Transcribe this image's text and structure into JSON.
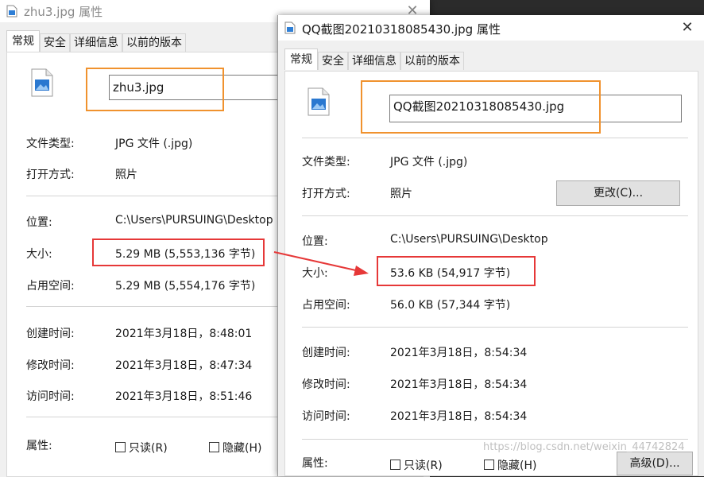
{
  "colors": {
    "highlight_orange": "#f0922e",
    "highlight_red": "#e63838"
  },
  "left_dialog": {
    "title": "zhu3.jpg 属性",
    "tabs": [
      "常规",
      "安全",
      "详细信息",
      "以前的版本"
    ],
    "filename": "zhu3.jpg",
    "rows": {
      "type_label": "文件类型:",
      "type_value": "JPG 文件 (.jpg)",
      "open_label": "打开方式:",
      "open_value": "照片",
      "location_label": "位置:",
      "location_value": "C:\\Users\\PURSUING\\Desktop",
      "size_label": "大小:",
      "size_value": "5.29 MB (5,553,136 字节)",
      "disk_label": "占用空间:",
      "disk_value": "5.29 MB (5,554,176 字节)",
      "created_label": "创建时间:",
      "created_value": "2021年3月18日，8:48:01",
      "modified_label": "修改时间:",
      "modified_value": "2021年3月18日，8:47:34",
      "accessed_label": "访问时间:",
      "accessed_value": "2021年3月18日，8:51:46",
      "attr_label": "属性:",
      "readonly": "只读(R)",
      "hidden": "隐藏(H)"
    }
  },
  "right_dialog": {
    "title": "QQ截图20210318085430.jpg 属性",
    "tabs": [
      "常规",
      "安全",
      "详细信息",
      "以前的版本"
    ],
    "filename": "QQ截图20210318085430.jpg",
    "change_button": "更改(C)...",
    "advanced_button": "高级(D)...",
    "rows": {
      "type_label": "文件类型:",
      "type_value": "JPG 文件 (.jpg)",
      "open_label": "打开方式:",
      "open_value": "照片",
      "location_label": "位置:",
      "location_value": "C:\\Users\\PURSUING\\Desktop",
      "size_label": "大小:",
      "size_value": "53.6 KB (54,917 字节)",
      "disk_label": "占用空间:",
      "disk_value": "56.0 KB (57,344 字节)",
      "created_label": "创建时间:",
      "created_value": "2021年3月18日，8:54:34",
      "modified_label": "修改时间:",
      "modified_value": "2021年3月18日，8:54:34",
      "accessed_label": "访问时间:",
      "accessed_value": "2021年3月18日，8:54:34",
      "attr_label": "属性:",
      "readonly": "只读(R)",
      "hidden": "隐藏(H)"
    }
  },
  "watermark": "https://blog.csdn.net/weixin_44742824"
}
